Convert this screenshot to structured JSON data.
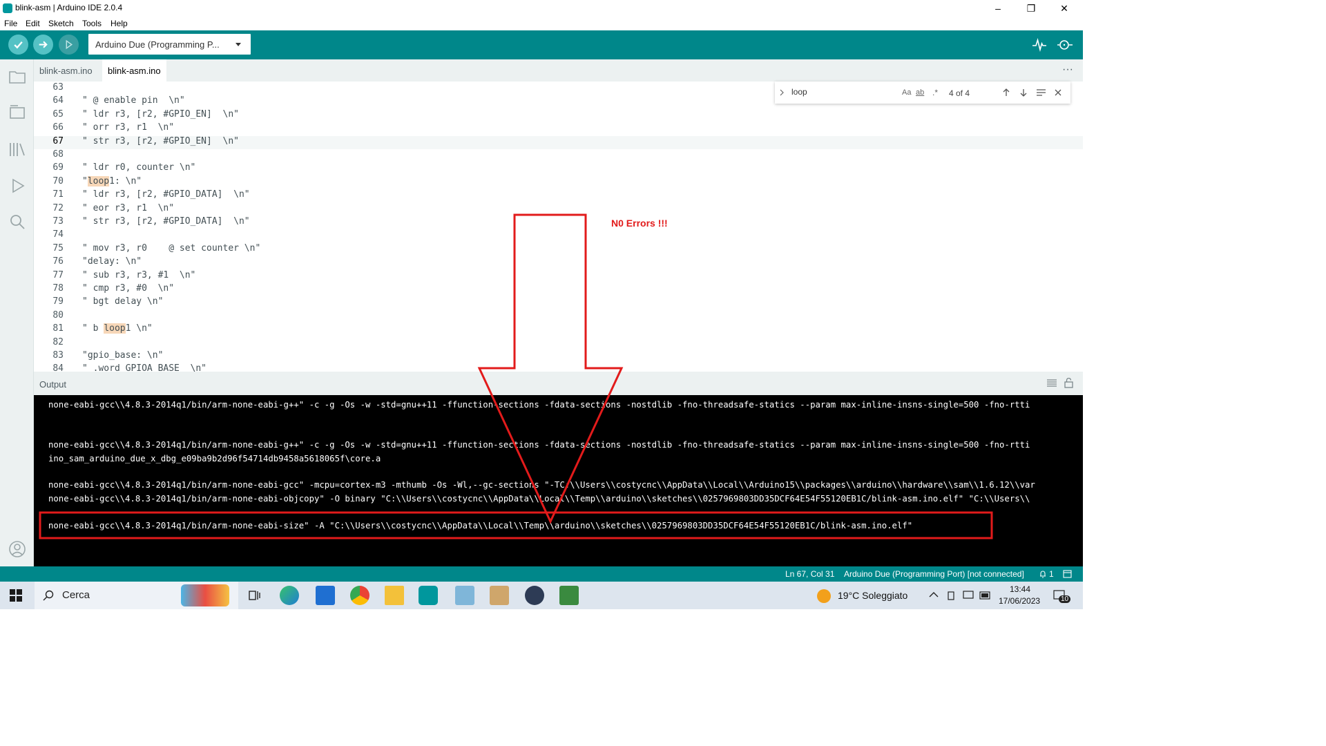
{
  "window": {
    "title": "blink-asm | Arduino IDE 2.0.4",
    "minimize": "–",
    "maximize": "❐",
    "close": "✕"
  },
  "menu": [
    "File",
    "Edit",
    "Sketch",
    "Tools",
    "Help"
  ],
  "toolbar": {
    "verify_icon": "check-icon",
    "upload_icon": "arrow-right-icon",
    "debug_icon": "debug-icon",
    "board_selector": "Arduino Due (Programming P...",
    "serial_plotter_icon": "pulse-icon",
    "serial_monitor_icon": "magnifier-dots-icon"
  },
  "tabs": [
    "blink-asm.ino",
    "blink-asm.ino"
  ],
  "tabs_more": "···",
  "editor": {
    "lines": [
      {
        "n": "63",
        "text": ""
      },
      {
        "n": "64",
        "text": "\" @ enable pin  \\n\""
      },
      {
        "n": "65",
        "text": "\" ldr r3, [r2, #GPIO_EN]  \\n\""
      },
      {
        "n": "66",
        "text": "\" orr r3, r1  \\n\""
      },
      {
        "n": "67",
        "text": "\" str r3, [r2, #GPIO_EN]  \\n\""
      },
      {
        "n": "68",
        "text": ""
      },
      {
        "n": "69",
        "text": "\" ldr r0, counter \\n\""
      },
      {
        "n": "70",
        "pre": "\"",
        "hl": "loop",
        "post": "1: \\n\""
      },
      {
        "n": "71",
        "text": "\" ldr r3, [r2, #GPIO_DATA]  \\n\""
      },
      {
        "n": "72",
        "text": "\" eor r3, r1  \\n\""
      },
      {
        "n": "73",
        "text": "\" str r3, [r2, #GPIO_DATA]  \\n\""
      },
      {
        "n": "74",
        "text": ""
      },
      {
        "n": "75",
        "text": "\" mov r3, r0    @ set counter \\n\""
      },
      {
        "n": "76",
        "text": "\"delay: \\n\""
      },
      {
        "n": "77",
        "text": "\" sub r3, r3, #1  \\n\""
      },
      {
        "n": "78",
        "text": "\" cmp r3, #0  \\n\""
      },
      {
        "n": "79",
        "text": "\" bgt delay \\n\""
      },
      {
        "n": "80",
        "text": ""
      },
      {
        "n": "81",
        "pre": "\" b ",
        "hl": "loop",
        "post": "1 \\n\""
      },
      {
        "n": "82",
        "text": ""
      },
      {
        "n": "83",
        "text": "\"gpio_base: \\n\""
      },
      {
        "n": "84",
        "text": "\" .word GPIOA_BASE  \\n\""
      }
    ]
  },
  "find": {
    "query": "loop",
    "case_label": "Aa",
    "word_label": "ab",
    "regex_label": ".*",
    "count": "4 of 4"
  },
  "output": {
    "header": "Output",
    "lines": [
      "none-eabi-gcc\\\\4.8.3-2014q1/bin/arm-none-eabi-g++\" -c -g -Os -w -std=gnu++11 -ffunction-sections -fdata-sections -nostdlib -fno-threadsafe-statics --param max-inline-insns-single=500 -fno-rtti",
      "",
      "",
      "none-eabi-gcc\\\\4.8.3-2014q1/bin/arm-none-eabi-g++\" -c -g -Os -w -std=gnu++11 -ffunction-sections -fdata-sections -nostdlib -fno-threadsafe-statics --param max-inline-insns-single=500 -fno-rtti",
      "ino_sam_arduino_due_x_dbg_e09ba9b2d96f54714db9458a5618065f\\core.a",
      "",
      "none-eabi-gcc\\\\4.8.3-2014q1/bin/arm-none-eabi-gcc\" -mcpu=cortex-m3 -mthumb -Os -Wl,--gc-sections \"-TC:\\\\Users\\\\costycnc\\\\AppData\\\\Local\\\\Arduino15\\\\packages\\\\arduino\\\\hardware\\\\sam\\\\1.6.12\\\\var",
      "none-eabi-gcc\\\\4.8.3-2014q1/bin/arm-none-eabi-objcopy\" -O binary \"C:\\\\Users\\\\costycnc\\\\AppData\\\\Local\\\\Temp\\\\arduino\\\\sketches\\\\0257969803DD35DCF64E54F55120EB1C/blink-asm.ino.elf\" \"C:\\\\Users\\\\",
      "",
      "none-eabi-gcc\\\\4.8.3-2014q1/bin/arm-none-eabi-size\" -A \"C:\\\\Users\\\\costycnc\\\\AppData\\\\Local\\\\Temp\\\\arduino\\\\sketches\\\\0257969803DD35DCF64E54F55120EB1C/blink-asm.ino.elf\""
    ]
  },
  "annotation": "N0 Errors !!!",
  "status": {
    "position": "Ln 67, Col 31",
    "board": "Arduino Due (Programming Port) [not connected]",
    "notifications": "1"
  },
  "taskbar": {
    "search": "Cerca",
    "weather": "19°C  Soleggiato",
    "time": "13:44",
    "date": "17/06/2023",
    "notif_count": "10"
  },
  "colors": {
    "teal": "#00878a",
    "highlight": "#f7d7b8",
    "annotation": "#e21b1b"
  }
}
